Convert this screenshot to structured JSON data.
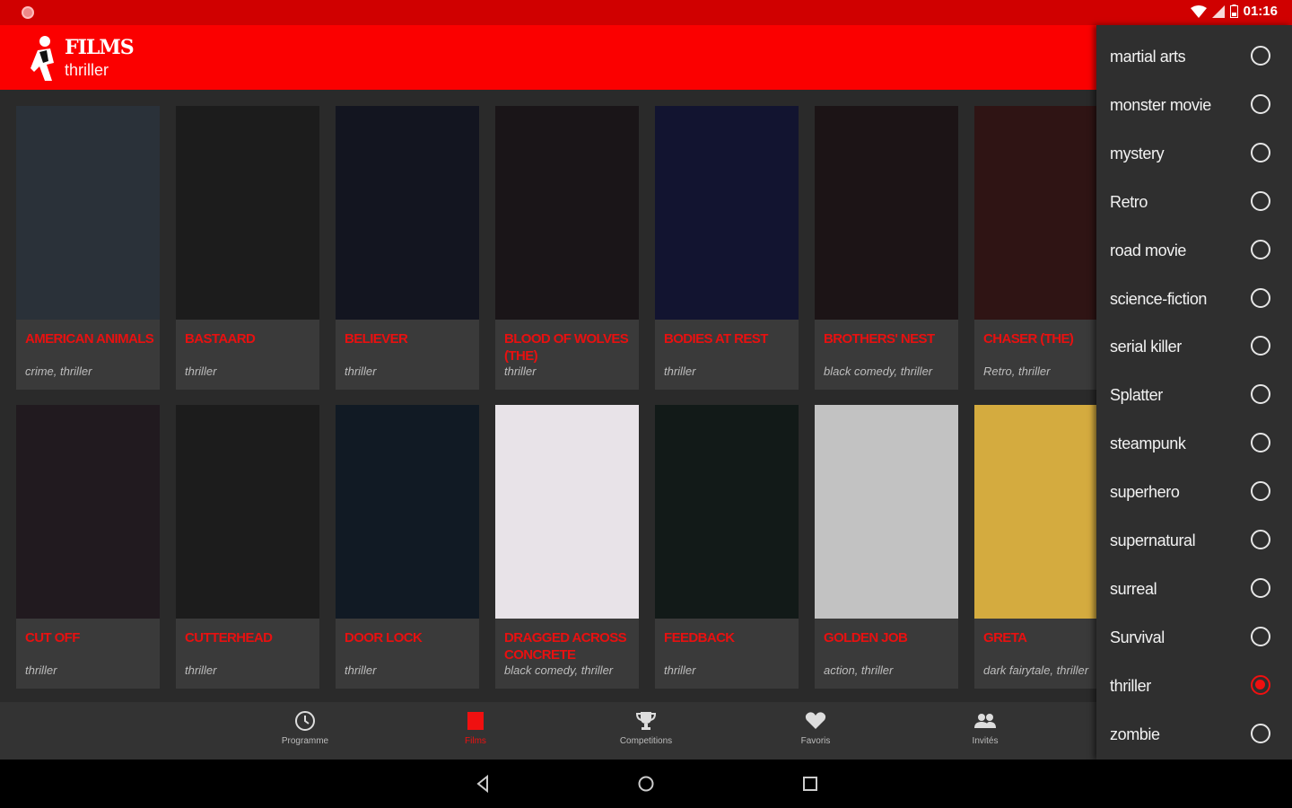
{
  "status": {
    "time": "01:16"
  },
  "app": {
    "title": "FILMS",
    "subtitle": "thriller",
    "accent": "#fb0000"
  },
  "films": [
    {
      "title": "AMERICAN ANIMALS",
      "tags": "crime, thriller",
      "poster": "#2a3139"
    },
    {
      "title": "BASTAARD",
      "tags": "thriller",
      "poster": "#1c1c1c"
    },
    {
      "title": "BELIEVER",
      "tags": "thriller",
      "poster": "#131520"
    },
    {
      "title": "BLOOD OF WOLVES (THE)",
      "tags": "thriller",
      "poster": "#1a1518"
    },
    {
      "title": "BODIES AT REST",
      "tags": "thriller",
      "poster": "#121430"
    },
    {
      "title": "BROTHERS' NEST",
      "tags": "black comedy, thriller",
      "poster": "#1c1416"
    },
    {
      "title": "CHASER (THE)",
      "tags": "Retro, thriller",
      "poster": "#2f1414"
    },
    {
      "title": "CUT OFF",
      "tags": "thriller",
      "poster": "#211a1f"
    },
    {
      "title": "CUTTERHEAD",
      "tags": "thriller",
      "poster": "#1c1c1c"
    },
    {
      "title": "DOOR LOCK",
      "tags": "thriller",
      "poster": "#111a24"
    },
    {
      "title": "DRAGGED ACROSS CONCRETE",
      "tags": "black comedy, thriller",
      "poster": "#e8e3e8"
    },
    {
      "title": "FEEDBACK",
      "tags": "thriller",
      "poster": "#121a18"
    },
    {
      "title": "GOLDEN JOB",
      "tags": "action, thriller",
      "poster": "#c2c2c2"
    },
    {
      "title": "GRETA",
      "tags": "dark fairytale, thriller",
      "poster": "#d4ab3f"
    }
  ],
  "nav": [
    {
      "label": "Programme",
      "icon": "clock-icon"
    },
    {
      "label": "Films",
      "icon": "film-icon",
      "active": true
    },
    {
      "label": "Competitions",
      "icon": "trophy-icon"
    },
    {
      "label": "Favoris",
      "icon": "heart-icon"
    },
    {
      "label": "Invités",
      "icon": "people-icon"
    }
  ],
  "genres": [
    {
      "label": "martial arts",
      "checked": false
    },
    {
      "label": "monster movie",
      "checked": false
    },
    {
      "label": "mystery",
      "checked": false
    },
    {
      "label": "Retro",
      "checked": false
    },
    {
      "label": "road movie",
      "checked": false
    },
    {
      "label": "science-fiction",
      "checked": false
    },
    {
      "label": "serial killer",
      "checked": false
    },
    {
      "label": "Splatter",
      "checked": false
    },
    {
      "label": "steampunk",
      "checked": false
    },
    {
      "label": "superhero",
      "checked": false
    },
    {
      "label": "supernatural",
      "checked": false
    },
    {
      "label": "surreal",
      "checked": false
    },
    {
      "label": "Survival",
      "checked": false
    },
    {
      "label": "thriller",
      "checked": true
    },
    {
      "label": "zombie",
      "checked": false
    }
  ]
}
